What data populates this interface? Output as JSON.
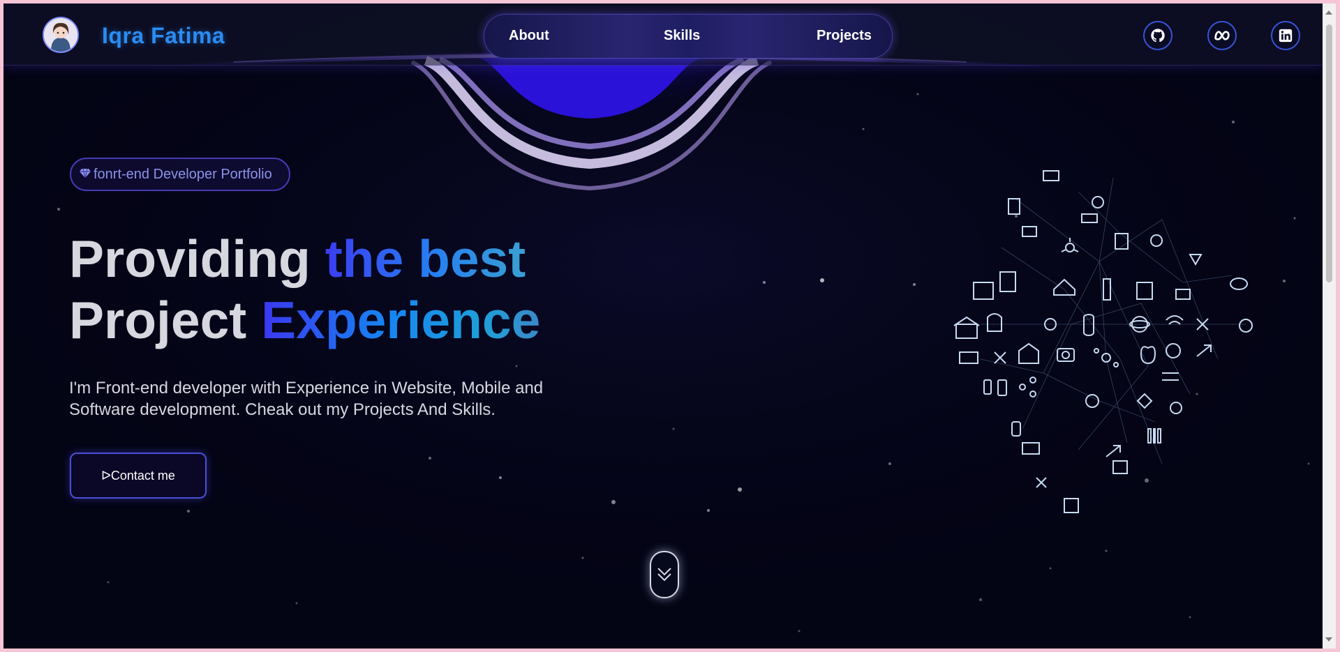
{
  "header": {
    "brand": "Iqra Fatima",
    "nav": [
      "About",
      "Skills",
      "Projects"
    ],
    "social": [
      {
        "icon": "github-icon"
      },
      {
        "icon": "meta-icon"
      },
      {
        "icon": "linkedin-icon"
      }
    ]
  },
  "hero": {
    "badge_text": "fonrt-end Developer Portfolio",
    "headline_line1_plain": "Providing ",
    "headline_line1_highlight": "the best",
    "headline_line2_plain": "Project ",
    "headline_line2_highlight": "Experience",
    "lede": "I'm Front-end developer with Experience in Website, Mobile and Software development. Cheak out my Projects And Skills.",
    "contact_button": "ᐅContact me"
  },
  "colors": {
    "background": "#030414",
    "accent_blue": "#2b8cf2",
    "accent_purple": "#473bb6",
    "text_light": "#d7d8df"
  }
}
